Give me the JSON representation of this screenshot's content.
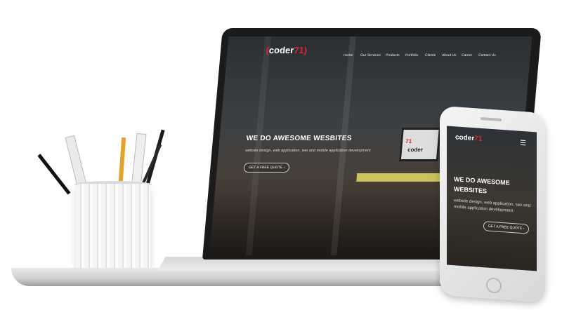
{
  "laptop": {
    "logo_main": "coder",
    "logo_accent": "71",
    "nav": [
      "Home",
      "Our Services",
      "Products",
      "Portfolio",
      "Clients",
      "About Us",
      "Career",
      "Contact Us"
    ],
    "hero_title": "WE DO AWESOME WESBITES",
    "hero_subtitle": "website design, web application, seo and mobile application development",
    "hero_button": "GET A FREE QUOTE",
    "monitor_logo_main": "coder",
    "monitor_logo_accent": "71"
  },
  "phone": {
    "logo_main": "coder",
    "logo_accent": "71",
    "menu_icon": "hamburger-icon",
    "hero_title": "WE DO AWESOME WEBSITES",
    "hero_subtitle": "website design, web application, seo and mobile application development.",
    "hero_button": "GET A FREE QUOTE"
  },
  "colors": {
    "accent": "#d9262c",
    "screen_dark": "#2b2f33",
    "desk_yellow": "#c8c35a"
  }
}
